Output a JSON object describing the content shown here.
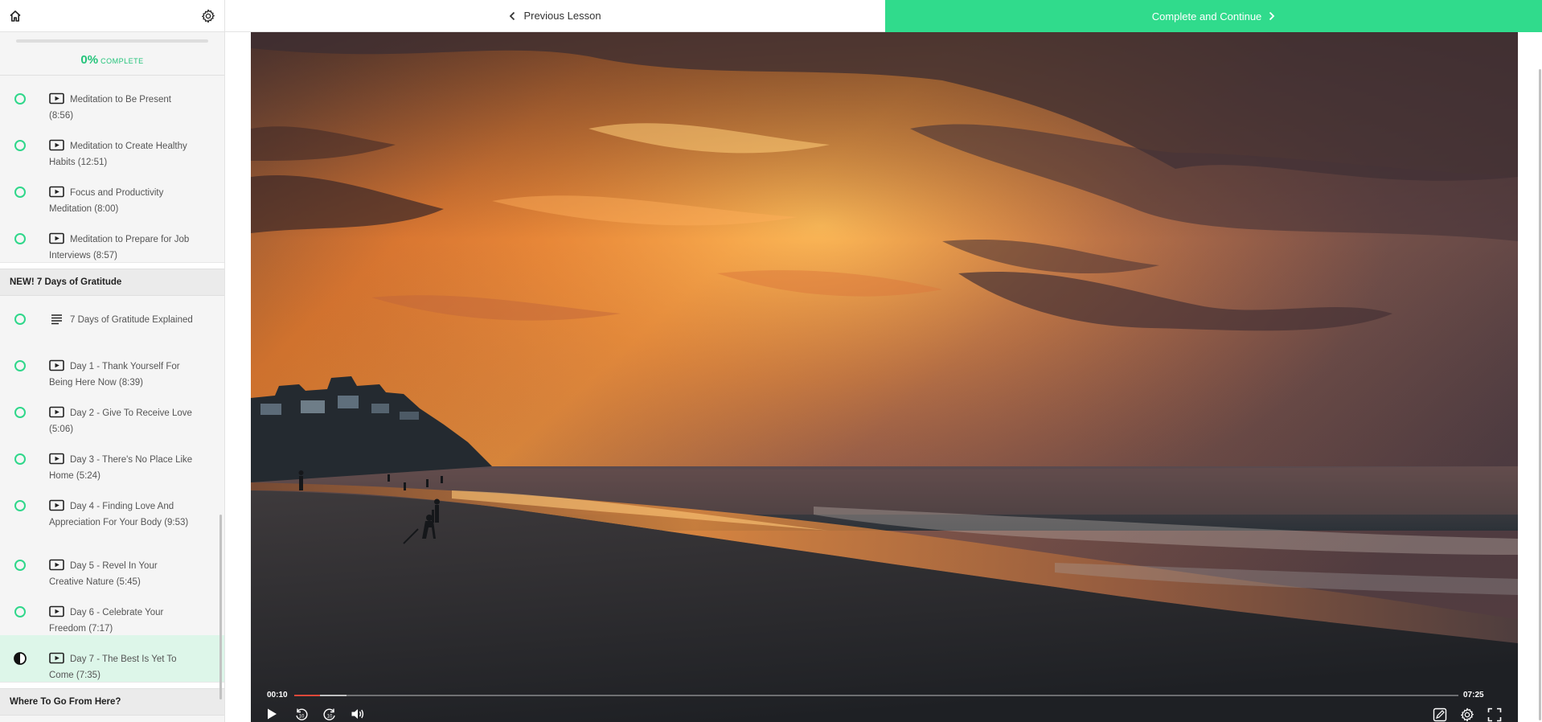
{
  "nav": {
    "previous_label": "Previous Lesson",
    "next_label": "Complete and Continue"
  },
  "icons": {
    "home": "home-icon",
    "settings": "gear-icon",
    "video_lesson": "video-play-icon",
    "text_lesson": "text-lines-icon",
    "complete": "circle-outline-icon",
    "in_progress": "half-circle-icon"
  },
  "colors": {
    "accent": "#30db8c",
    "active_row": "#ddf6e9",
    "seek_played": "#e0493a"
  },
  "progress": {
    "percent": "0%",
    "label": "COMPLETE",
    "fraction": 0
  },
  "lessons_top": [
    {
      "title": "Meditation to Be Present (8:56)",
      "type": "video"
    },
    {
      "title": "Meditation to Create Healthy Habits (12:51)",
      "type": "video"
    },
    {
      "title": "Focus and Productivity Meditation (8:00)",
      "type": "video"
    },
    {
      "title": "Meditation to Prepare for Job Interviews (8:57)",
      "type": "video"
    }
  ],
  "section_gratitude": {
    "title": "NEW! 7 Days of Gratitude",
    "lessons": [
      {
        "title": "7 Days of Gratitude Explained",
        "type": "text"
      },
      {
        "title": "Day 1 - Thank Yourself For Being Here Now (8:39)",
        "type": "video"
      },
      {
        "title": "Day 2 - Give To Receive Love (5:06)",
        "type": "video"
      },
      {
        "title": "Day 3 - There's No Place Like Home (5:24)",
        "type": "video"
      },
      {
        "title": "Day 4 - Finding Love And Appreciation For Your Body (9:53)",
        "type": "video"
      },
      {
        "title": "Day 5 - Revel In Your Creative Nature (5:45)",
        "type": "video"
      },
      {
        "title": "Day 6 - Celebrate Your Freedom (7:17)",
        "type": "video"
      },
      {
        "title": "Day 7 - The Best Is Yet To Come (7:35)",
        "type": "video",
        "active": true
      }
    ]
  },
  "section_next": {
    "title": "Where To Go From Here?"
  },
  "video": {
    "current_time": "00:10",
    "total_time": "07:25",
    "played_fraction": 0.022,
    "buffered_fraction": 0.045
  },
  "player_controls": [
    "play-icon",
    "rewind-10-icon",
    "forward-10-icon",
    "volume-icon",
    "notes-icon",
    "settings-icon",
    "fullscreen-icon"
  ]
}
